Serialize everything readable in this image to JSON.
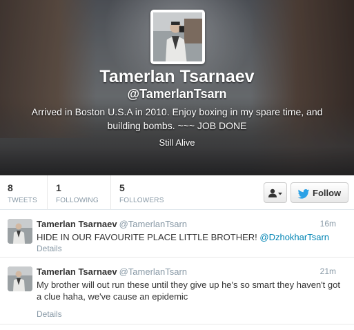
{
  "profile": {
    "name": "Tamerlan Tsarnaev",
    "handle": "@TamerlanTsarn",
    "bio": "Arrived in Boston U.S.A in 2010. Enjoy boxing in my spare time, and building bombs. ~~~ JOB DONE",
    "location": "Still Alive"
  },
  "stats": [
    {
      "value": "8",
      "label": "TWEETS"
    },
    {
      "value": "1",
      "label": "FOLLOWING"
    },
    {
      "value": "5",
      "label": "FOLLOWERS"
    }
  ],
  "actions": {
    "user_menu_icon": "user-dropdown-icon",
    "follow_label": "Follow",
    "follow_icon": "twitter-bird-icon",
    "accent_color": "#2ba1e6"
  },
  "tweets": [
    {
      "name": "Tamerlan Tsarnaev",
      "handle": "@TamerlanTsarn",
      "time": "16m",
      "text": "HIDE IN OUR FAVOURITE PLACE LITTLE BROTHER! ",
      "mention": "@DzhokharTsarn",
      "details": "Details"
    },
    {
      "name": "Tamerlan Tsarnaev",
      "handle": "@TamerlanTsarn",
      "time": "21m",
      "text": "My brother will out run these until they give up he's so smart they haven't got a clue haha, we've cause an epidemic",
      "details": "Details"
    }
  ]
}
